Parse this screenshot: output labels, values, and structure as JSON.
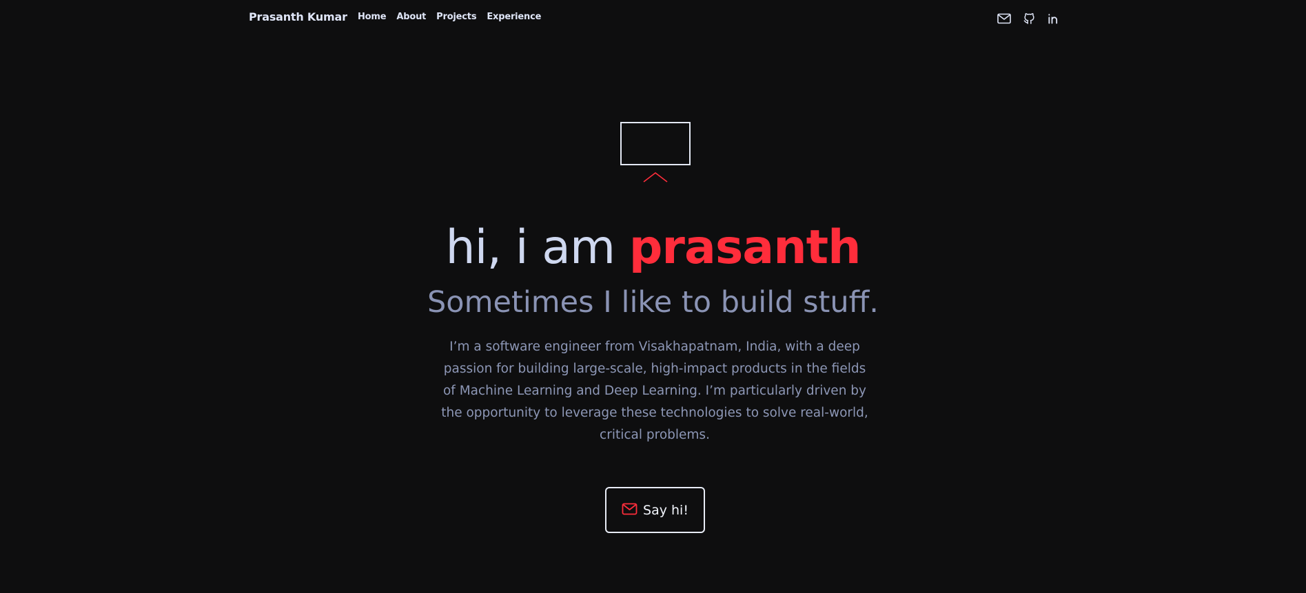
{
  "nav": {
    "brand": "Prasanth Kumar",
    "links": [
      {
        "label": "Home"
      },
      {
        "label": "About"
      },
      {
        "label": "Projects"
      },
      {
        "label": "Experience"
      }
    ],
    "social": [
      {
        "icon": "mail-icon"
      },
      {
        "icon": "github-icon"
      },
      {
        "icon": "linkedin-icon"
      }
    ]
  },
  "hero": {
    "greeting": "hi, i am ",
    "name": "prasanth",
    "tagline": "Sometimes I like to build stuff.",
    "intro": "I’m a software engineer from Visakhapatnam, India, with a deep passion for building large-scale, high-impact products in the fields of Machine Learning and Deep Learning. I’m particularly driven by the opportunity to leverage these technologies to solve real-world, critical problems.",
    "cta_label": "Say hi!",
    "cta_icon": "mail-icon"
  },
  "colors": {
    "background": "#0e0e0f",
    "accent": "#ff2d3b",
    "text_primary": "#cfd8f0",
    "text_muted": "#8a93b4"
  }
}
